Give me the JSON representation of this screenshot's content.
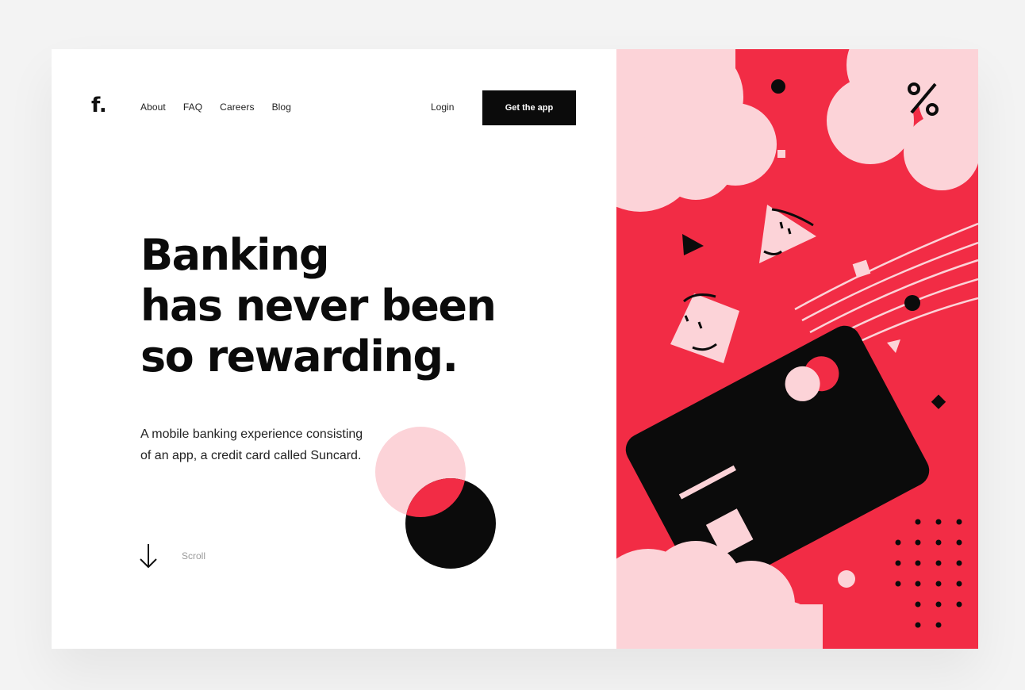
{
  "brand": {
    "logo": "f.",
    "accent": "#f22c45",
    "dark": "#0b0b0b",
    "pink": "#fcd3d8"
  },
  "nav": {
    "items": [
      "About",
      "FAQ",
      "Careers",
      "Blog"
    ]
  },
  "auth": {
    "login": "Login",
    "cta": "Get the app"
  },
  "hero": {
    "headline": [
      "Banking",
      "has never been",
      "so rewarding."
    ],
    "subtext": [
      "A mobile banking experience consisting",
      "of an app, a credit card called Suncard."
    ]
  },
  "scroll": {
    "label": "Scroll",
    "icon": "arrow-down-icon"
  },
  "illustration": {
    "percent_symbol": "%"
  }
}
